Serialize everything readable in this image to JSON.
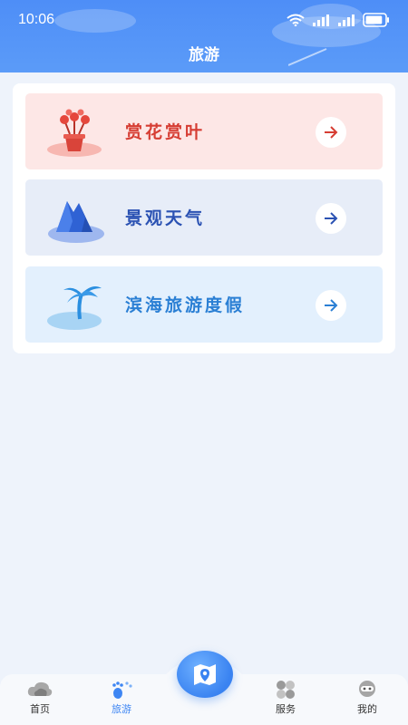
{
  "status_bar": {
    "time": "10:06",
    "battery_level": 0.85
  },
  "header": {
    "title": "旅游"
  },
  "items": [
    {
      "label": "赏花赏叶",
      "icon": "flower-pot-icon",
      "color": "#d63d33"
    },
    {
      "label": "景观天气",
      "icon": "mountain-icon",
      "color": "#2b52b3"
    },
    {
      "label": "滨海旅游度假",
      "icon": "palm-island-icon",
      "color": "#2a7fd4"
    }
  ],
  "bottom_nav": {
    "items": [
      {
        "label": "首页",
        "icon": "cloud-home-icon"
      },
      {
        "label": "旅游",
        "icon": "footprints-icon",
        "active": true
      },
      {
        "label": "服务",
        "icon": "service-grid-icon"
      },
      {
        "label": "我的",
        "icon": "profile-icon"
      }
    ],
    "center_icon": "map-icon"
  },
  "colors": {
    "header": "#4e8ef7",
    "active_nav": "#3e86f3",
    "background": "#eef3fb"
  }
}
